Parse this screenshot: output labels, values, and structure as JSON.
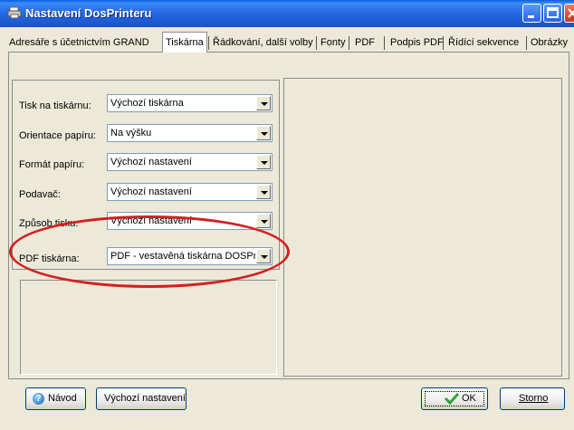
{
  "window": {
    "title": "Nastavení DosPrinteru",
    "icons": {
      "app": "printer-icon",
      "minimize": "minimize-icon",
      "maximize": "maximize-icon",
      "close": "close-icon"
    }
  },
  "tabs": [
    {
      "label": "Adresáře s účetnictvím GRAND",
      "selected": false
    },
    {
      "label": "Tiskárna",
      "selected": true
    },
    {
      "label": "Řádkování, další volby",
      "selected": false
    },
    {
      "label": "Fonty",
      "selected": false
    },
    {
      "label": "PDF",
      "selected": false
    },
    {
      "label": "Podpis PDF",
      "selected": false
    },
    {
      "label": "Řídící sekvence",
      "selected": false
    },
    {
      "label": "Obrázky",
      "selected": false
    }
  ],
  "fields": [
    {
      "label": "Tisk na tiskárnu:",
      "value": "Výchozí tiskárna"
    },
    {
      "label": "Orientace papíru:",
      "value": "Na výšku"
    },
    {
      "label": "Formát papíru:",
      "value": "Výchozí nastavení"
    },
    {
      "label": "Podavač:",
      "value": "Výchozí nastavení"
    },
    {
      "label": "Způsob tisku:",
      "value": "Výchozí nastavení"
    },
    {
      "label": "PDF tiskárna:",
      "value": "PDF - vestavěná tiskárna DOSPrin"
    }
  ],
  "buttons": {
    "help": "Návod",
    "defaults": "Výchozí nastavení",
    "ok": "OK",
    "cancel": "Storno"
  },
  "colors": {
    "highlight_oval": "#d42020",
    "titlebar": "#1f5fd8",
    "window_bg": "#ECE9D8"
  }
}
